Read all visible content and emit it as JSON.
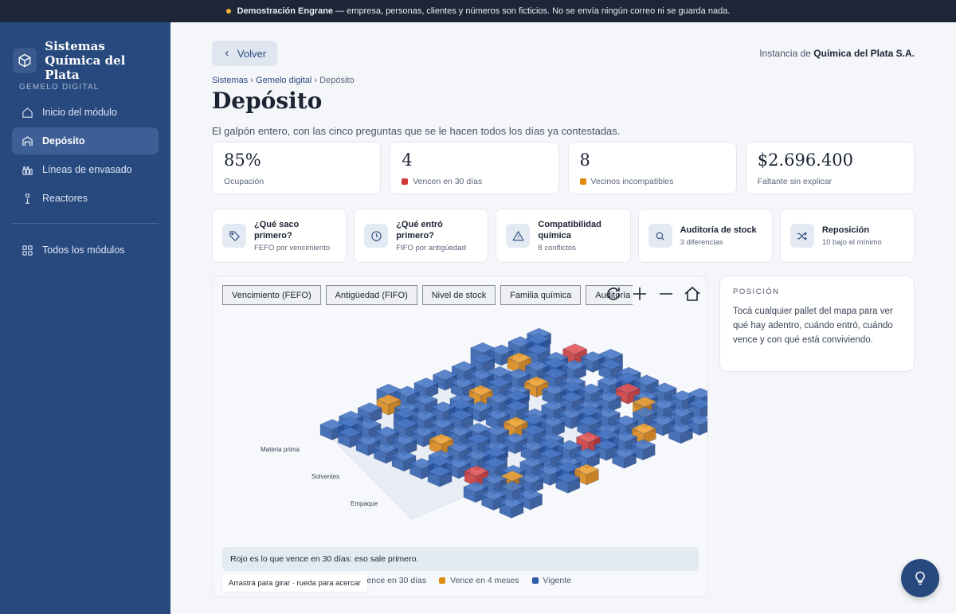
{
  "banner": {
    "title": "Demostración Engrane",
    "text": " — empresa, personas, clientes y números son ficticios. No se envía ningún correo ni se guarda nada."
  },
  "sidebar": {
    "brand_line1": "Sistemas",
    "brand_line2": "Química del Plata",
    "section": "GEMELO DIGITAL",
    "items": [
      {
        "label": "Inicio del módulo",
        "icon": "home-icon"
      },
      {
        "label": "Depósito",
        "icon": "warehouse-icon",
        "active": true
      },
      {
        "label": "Líneas de envasado",
        "icon": "bottles-icon"
      },
      {
        "label": "Reactores",
        "icon": "flask-icon"
      }
    ],
    "all_modules": "Todos los módulos"
  },
  "header": {
    "back": "Volver",
    "instance_prefix": "Instancia de",
    "instance_name": "Química del Plata S.A.",
    "breadcrumb": [
      "Sistemas",
      "Gemelo digital",
      "Depósito"
    ],
    "title": "Depósito",
    "subtitle": "El galpón entero, con las cinco preguntas que se le hacen todos los días ya contestadas."
  },
  "stats": [
    {
      "value": "85%",
      "label": "Ocupación"
    },
    {
      "value": "4",
      "label": "Vencen en 30 días",
      "color": "#d23a3a"
    },
    {
      "value": "8",
      "label": "Vecinos incompatibles",
      "color": "#e08a0e"
    },
    {
      "value": "$2.696.400",
      "label": "Faltante sin explicar"
    }
  ],
  "actions": [
    {
      "title": "¿Qué saco primero?",
      "sub": "FEFO por vencimiento",
      "icon": "tag-icon"
    },
    {
      "title": "¿Qué entró primero?",
      "sub": "FIFO por antigüedad",
      "icon": "clock-icon"
    },
    {
      "title": "Compatibilidad química",
      "sub": "8 conflictos",
      "icon": "warning-icon"
    },
    {
      "title": "Auditoría de stock",
      "sub": "3 diferencias",
      "icon": "search-icon"
    },
    {
      "title": "Reposición",
      "sub": "10 bajo el mínimo",
      "icon": "shuffle-icon"
    }
  ],
  "viewer": {
    "modes": [
      "Vencimiento (FEFO)",
      "Antigüedad (FIFO)",
      "Nivel de stock",
      "Familia química",
      "Auditoría"
    ],
    "zones": [
      "Materia prima",
      "Solventes",
      "Empaque"
    ],
    "info": "Rojo es lo que vence en 30 días: eso sale primero.",
    "legend": [
      {
        "label": "Vence en 30 días",
        "color": "#d23a3a"
      },
      {
        "label": "Vence en 4 meses",
        "color": "#e08a0e"
      },
      {
        "label": "Vigente",
        "color": "#2d5aa8"
      }
    ],
    "hint": "Arrastrá para girar · rueda para acercar"
  },
  "position": {
    "heading": "POSICIÓN",
    "text": "Tocá cualquier pallet del mapa para ver qué hay adentro, cuándo entró, cuándo vence y con qué está conviviendo."
  }
}
